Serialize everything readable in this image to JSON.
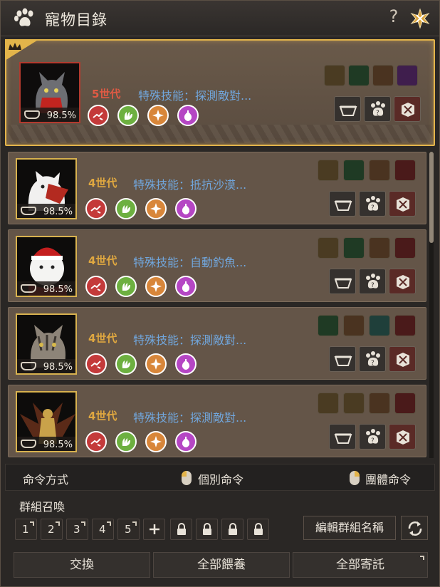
{
  "window": {
    "title": "寵物目錄",
    "help": "?"
  },
  "pets": [
    {
      "generation": "5世代",
      "skill": "特殊技能：探測敵對...",
      "hunger": "98.5%"
    },
    {
      "generation": "4世代",
      "skill": "特殊技能：抵抗沙漠...",
      "hunger": "98.5%"
    },
    {
      "generation": "4世代",
      "skill": "特殊技能：自動釣魚...",
      "hunger": "98.5%"
    },
    {
      "generation": "4世代",
      "skill": "特殊技能：探測敵對...",
      "hunger": "98.5%"
    },
    {
      "generation": "4世代",
      "skill": "特殊技能：探測敵對...",
      "hunger": "98.5%"
    }
  ],
  "command": {
    "label": "命令方式",
    "single": "個別命令",
    "group": "團體命令"
  },
  "summon": {
    "title": "群組召喚",
    "slots": [
      "1",
      "2",
      "3",
      "4",
      "5"
    ],
    "edit_label": "編輯群組名稱"
  },
  "buttons": {
    "exchange": "交換",
    "feed_all": "全部餵養",
    "deposit_all": "全部寄託"
  },
  "colors": {
    "gold": "#e3b44a",
    "skill_blue": "#71a6dc",
    "gen_orange": "#e0a840",
    "gen_red": "#e05a44"
  }
}
